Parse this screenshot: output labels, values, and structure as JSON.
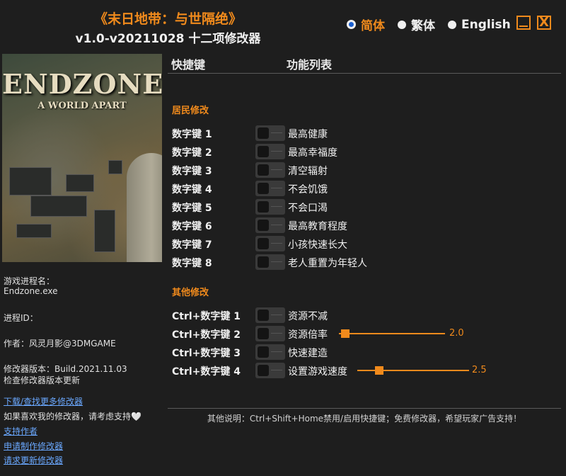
{
  "title": {
    "main": "《末日地带：与世隔绝》",
    "sub": "v1.0-v20211028 十二项修改器"
  },
  "languages": [
    {
      "label": "简体",
      "selected": true
    },
    {
      "label": "繁体",
      "selected": false
    },
    {
      "label": "English",
      "selected": false
    }
  ],
  "window_buttons": {
    "minimize": "minimize-icon",
    "close": "X"
  },
  "cover": {
    "logo": "ENDZONE",
    "sublogo": "A WORLD APART"
  },
  "info": {
    "process_label": "游戏进程名：",
    "process_value": "Endzone.exe",
    "pid_label": "进程ID：",
    "author": "作者：风灵月影@3DMGAME",
    "version": "修改器版本：Build.2021.11.03",
    "check_update": "检查修改器版本更新",
    "download_more": "下载/查找更多修改器",
    "support_text": "如果喜欢我的修改器，请考虑支持🤍",
    "support_author": "支持作者",
    "request_trainer": "申请制作修改器",
    "request_update": "请求更新修改器"
  },
  "header": {
    "hotkey": "快捷键",
    "functions": "功能列表"
  },
  "sections": {
    "residents": "居民修改",
    "other": "其他修改"
  },
  "resident_cheats": [
    {
      "key": "数字键 1",
      "label": "最高健康",
      "on": false
    },
    {
      "key": "数字键 2",
      "label": "最高幸福度",
      "on": false
    },
    {
      "key": "数字键 3",
      "label": "清空辐射",
      "on": false
    },
    {
      "key": "数字键 4",
      "label": "不会饥饿",
      "on": false
    },
    {
      "key": "数字键 5",
      "label": "不会口渴",
      "on": false
    },
    {
      "key": "数字键 6",
      "label": "最高教育程度",
      "on": false
    },
    {
      "key": "数字键 7",
      "label": "小孩快速长大",
      "on": false
    },
    {
      "key": "数字键 8",
      "label": "老人重置为年轻人",
      "on": false
    }
  ],
  "other_cheats": [
    {
      "key": "Ctrl+数字键 1",
      "label": "资源不减",
      "on": false
    },
    {
      "key": "Ctrl+数字键 2",
      "label": "资源倍率",
      "on": false,
      "slider_value": "2.0",
      "slider_fraction": 0.02
    },
    {
      "key": "Ctrl+数字键 3",
      "label": "快速建造",
      "on": false
    },
    {
      "key": "Ctrl+数字键 4",
      "label": "设置游戏速度",
      "on": false,
      "slider_value": "2.5",
      "slider_fraction": 0.17
    }
  ],
  "colors": {
    "accent": "#f08a1c",
    "background": "#1e1e1e",
    "link": "#6aa8ff",
    "radio_selected": "#1a5fd0"
  },
  "footer": "其他说明：Ctrl+Shift+Home禁用/启用快捷键；免费修改器，希望玩家广告支持！"
}
